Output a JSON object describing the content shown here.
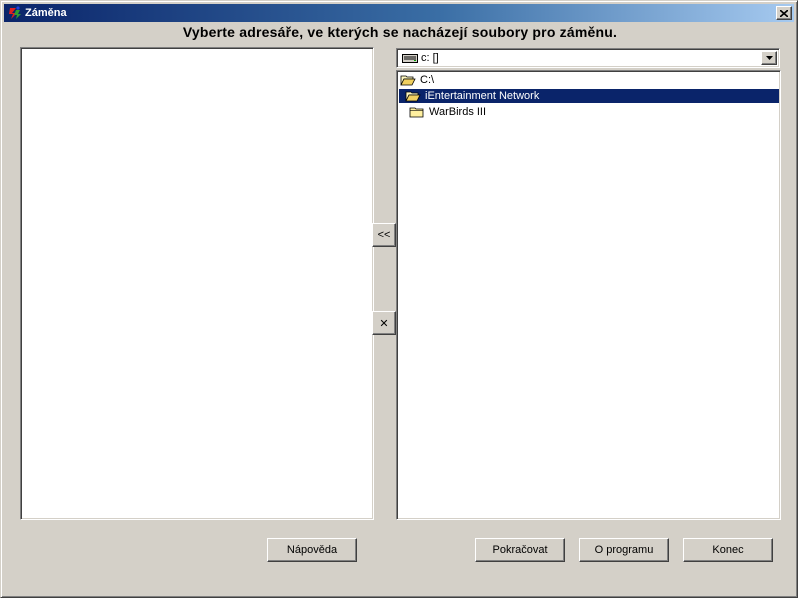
{
  "window": {
    "title": "Záměna",
    "heading": "Vyberte adresáře, ve kterých se nacházejí soubory pro záměnu."
  },
  "drive_selector": {
    "value": "c: []"
  },
  "folder_tree": {
    "items": [
      {
        "label": "C:\\",
        "icon": "folder-open-icon",
        "selected": false
      },
      {
        "label": "iEntertainment Network",
        "icon": "folder-open-icon",
        "selected": true
      },
      {
        "label": "WarBirds III",
        "icon": "folder-closed-icon",
        "selected": false
      }
    ]
  },
  "middle_buttons": {
    "add_label": "<<",
    "remove_label": "✕"
  },
  "buttons": {
    "help": "Nápověda",
    "continue": "Pokračovat",
    "about": "O programu",
    "exit": "Konec"
  },
  "colors": {
    "face": "#d4d0c8",
    "title_start": "#0a246a",
    "title_end": "#a6caf0",
    "selection": "#0a246a"
  }
}
